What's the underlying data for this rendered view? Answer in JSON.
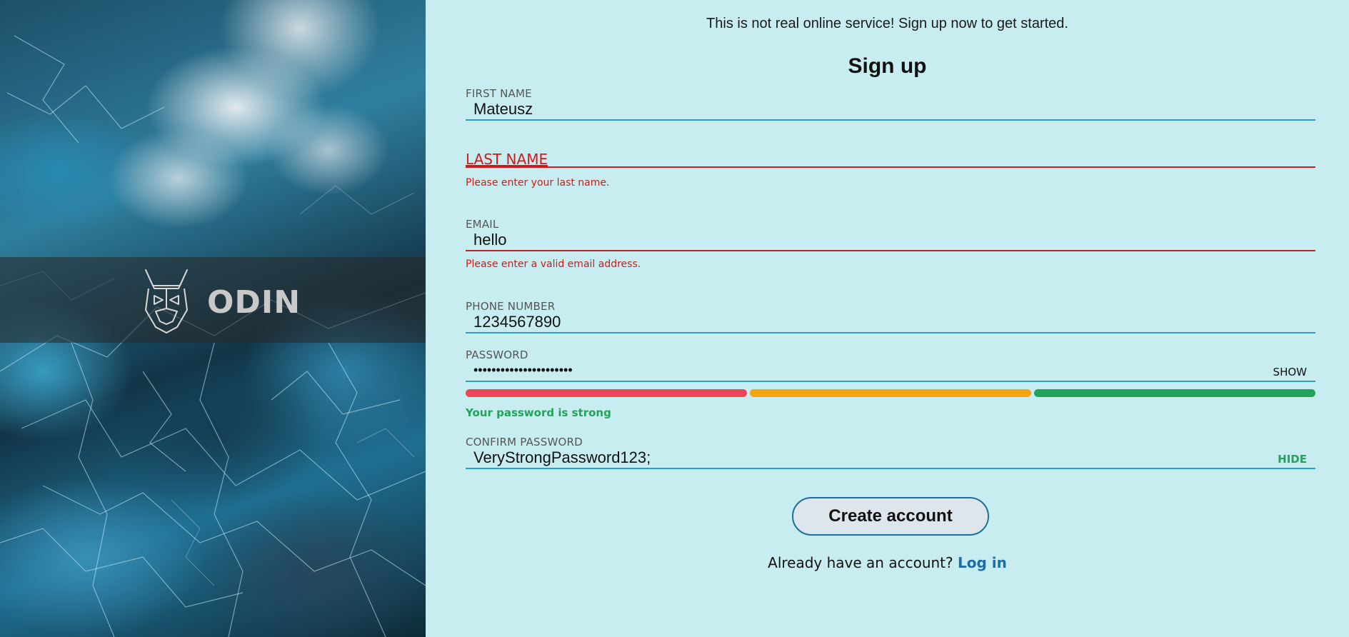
{
  "brand": {
    "name": "ODIN",
    "logo_icon": "odin-head-icon"
  },
  "header": {
    "tagline": "This is not real online service! Sign up now to get started.",
    "title": "Sign up"
  },
  "form": {
    "first_name": {
      "label": "FIRST NAME",
      "value": "Mateusz"
    },
    "last_name": {
      "label": "LAST NAME",
      "value": "",
      "error": "Please enter your last name."
    },
    "email": {
      "label": "EMAIL",
      "value": "hello",
      "error": "Please enter a valid email address."
    },
    "phone": {
      "label": "PHONE NUMBER",
      "value": "1234567890"
    },
    "password": {
      "label": "PASSWORD",
      "value": "••••••••••••••••••••••",
      "toggle_label": "SHOW",
      "strength_message": "Your password is strong",
      "strength_colors": [
        "#ec4657",
        "#f5a50a",
        "#22a35a"
      ]
    },
    "confirm_password": {
      "label": "CONFIRM PASSWORD",
      "value": "VeryStrongPassword123;",
      "toggle_label": "HIDE"
    },
    "submit_label": "Create account",
    "login_prompt": "Already have an account?",
    "login_link": "Log in"
  },
  "colors": {
    "accent_line": "#2a9fd0",
    "error": "#d11a1a",
    "success": "#22a35a",
    "background": "#c8edf0"
  }
}
